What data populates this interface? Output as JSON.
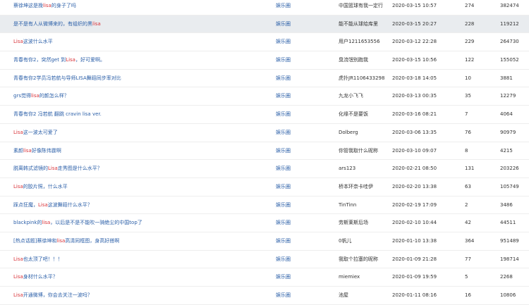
{
  "rows": [
    {
      "title_parts": [
        {
          "t": "蔡徐坤这是挽",
          "hl": false
        },
        {
          "t": "lisa",
          "hl": true
        },
        {
          "t": "的身子了吗",
          "hl": false
        }
      ],
      "board": "娱乐圈",
      "author": "中国篮球有我一定行",
      "date": "2020-03-15 10:57",
      "replies": "274",
      "views": "382474",
      "highlight": false
    },
    {
      "title_parts": [
        {
          "t": "是不是有人从微博来的，有组织的黑",
          "hl": false
        },
        {
          "t": "lisa",
          "hl": true
        }
      ],
      "board": "娱乐圈",
      "author": "能不能从球给库里",
      "date": "2020-03-15 20:27",
      "replies": "228",
      "views": "119212",
      "highlight": true
    },
    {
      "title_parts": [
        {
          "t": "Lisa",
          "hl": true
        },
        {
          "t": "这波什么水平",
          "hl": false
        }
      ],
      "board": "娱乐圈",
      "author": "用户1211653556",
      "date": "2020-03-12 22:28",
      "replies": "229",
      "views": "264730",
      "highlight": false
    },
    {
      "title_parts": [
        {
          "t": "青春有你2，突然get 到",
          "hl": false
        },
        {
          "t": "Lisa",
          "hl": true
        },
        {
          "t": "，好可爱啊。",
          "hl": false
        }
      ],
      "board": "娱乐圈",
      "author": "臭流氓别跑我",
      "date": "2020-03-15 10:56",
      "replies": "122",
      "views": "155052",
      "highlight": false
    },
    {
      "title_parts": [
        {
          "t": "青春有你2学员冯若航与导师LISA舞蹈同步率对比",
          "hl": false
        }
      ],
      "board": "娱乐圈",
      "author": "虎扑JR1106433298",
      "date": "2020-03-18 14:05",
      "replies": "10",
      "views": "3881",
      "highlight": false
    },
    {
      "title_parts": [
        {
          "t": "grs觉得",
          "hl": false
        },
        {
          "t": "lisa",
          "hl": true
        },
        {
          "t": "的颜怎么样？",
          "hl": false
        }
      ],
      "board": "娱乐圈",
      "author": "九龙小飞飞",
      "date": "2020-03-13 00:35",
      "replies": "35",
      "views": "12279",
      "highlight": false
    },
    {
      "title_parts": [
        {
          "t": "青春有你2 冯若航 翻跳 cravin lisa ver.",
          "hl": false
        }
      ],
      "board": "娱乐圈",
      "author": "化缘不是要饭",
      "date": "2020-03-16 08:21",
      "replies": "7",
      "views": "4064",
      "highlight": false
    },
    {
      "title_parts": [
        {
          "t": "Lisa",
          "hl": true
        },
        {
          "t": "这一波太可爱了",
          "hl": false
        }
      ],
      "board": "娱乐圈",
      "author": "Dolberg",
      "date": "2020-03-06 13:35",
      "replies": "76",
      "views": "90979",
      "highlight": false
    },
    {
      "title_parts": [
        {
          "t": "素颜",
          "hl": false
        },
        {
          "t": "lisa",
          "hl": true
        },
        {
          "t": "好像陈伟霆啊",
          "hl": false
        }
      ],
      "board": "娱乐圈",
      "author": "你管我取什么昵称",
      "date": "2020-03-10 09:07",
      "replies": "8",
      "views": "4215",
      "highlight": false
    },
    {
      "title_parts": [
        {
          "t": "脱离韩式滤镜的",
          "hl": false
        },
        {
          "t": "Lisa",
          "hl": true
        },
        {
          "t": "走秀图是什么水平？",
          "hl": false
        }
      ],
      "board": "娱乐圈",
      "author": "ars123",
      "date": "2020-02-21 08:50",
      "replies": "131",
      "views": "203226",
      "highlight": false
    },
    {
      "title_parts": [
        {
          "t": "Lisa",
          "hl": true
        },
        {
          "t": "的胶片照，什么水平",
          "hl": false
        }
      ],
      "board": "娱乐圈",
      "author": "桥本环奈卡哇伊",
      "date": "2020-02-20 13:38",
      "replies": "63",
      "views": "105749",
      "highlight": false
    },
    {
      "title_parts": [
        {
          "t": "踩点狂魔，",
          "hl": false
        },
        {
          "t": "Lisa",
          "hl": true
        },
        {
          "t": "这波舞蹈什么水平？",
          "hl": false
        }
      ],
      "board": "娱乐圈",
      "author": "TinTinn",
      "date": "2020-02-19 17:09",
      "replies": "2",
      "views": "3486",
      "highlight": false
    },
    {
      "title_parts": [
        {
          "t": "blackpink的",
          "hl": false
        },
        {
          "t": "lisa",
          "hl": true
        },
        {
          "t": "，以后是不是不能吹一骑绝尘的中国top了",
          "hl": false
        }
      ],
      "board": "娱乐圈",
      "author": "劳斯莱斯后场",
      "date": "2020-02-10 10:44",
      "replies": "42",
      "views": "44511",
      "highlight": false
    },
    {
      "title_parts": [
        {
          "t": "[热点话题]蔡徐坤和",
          "hl": false
        },
        {
          "t": "lisa",
          "hl": true
        },
        {
          "t": "高清同框图，身高好搭啊",
          "hl": false
        }
      ],
      "board": "娱乐圈",
      "author": "0帆儿",
      "date": "2020-01-10 13:38",
      "replies": "364",
      "views": "951489",
      "highlight": false
    },
    {
      "title_parts": [
        {
          "t": "Lisa",
          "hl": true
        },
        {
          "t": "也太顶了吧！！！",
          "hl": false
        }
      ],
      "board": "娱乐圈",
      "author": "我取个拉塞的昵称",
      "date": "2020-01-09 21:28",
      "replies": "77",
      "views": "198714",
      "highlight": false
    },
    {
      "title_parts": [
        {
          "t": "Lisa",
          "hl": true
        },
        {
          "t": "身材什么水平？",
          "hl": false
        }
      ],
      "board": "娱乐圈",
      "author": "miemiex",
      "date": "2020-01-09 19:59",
      "replies": "5",
      "views": "2268",
      "highlight": false
    },
    {
      "title_parts": [
        {
          "t": "Lisa",
          "hl": true
        },
        {
          "t": "开通微博，你会去关注一波吗？",
          "hl": false
        }
      ],
      "board": "娱乐圈",
      "author": "池屋",
      "date": "2020-01-11 08:16",
      "replies": "16",
      "views": "10806",
      "highlight": false
    }
  ]
}
